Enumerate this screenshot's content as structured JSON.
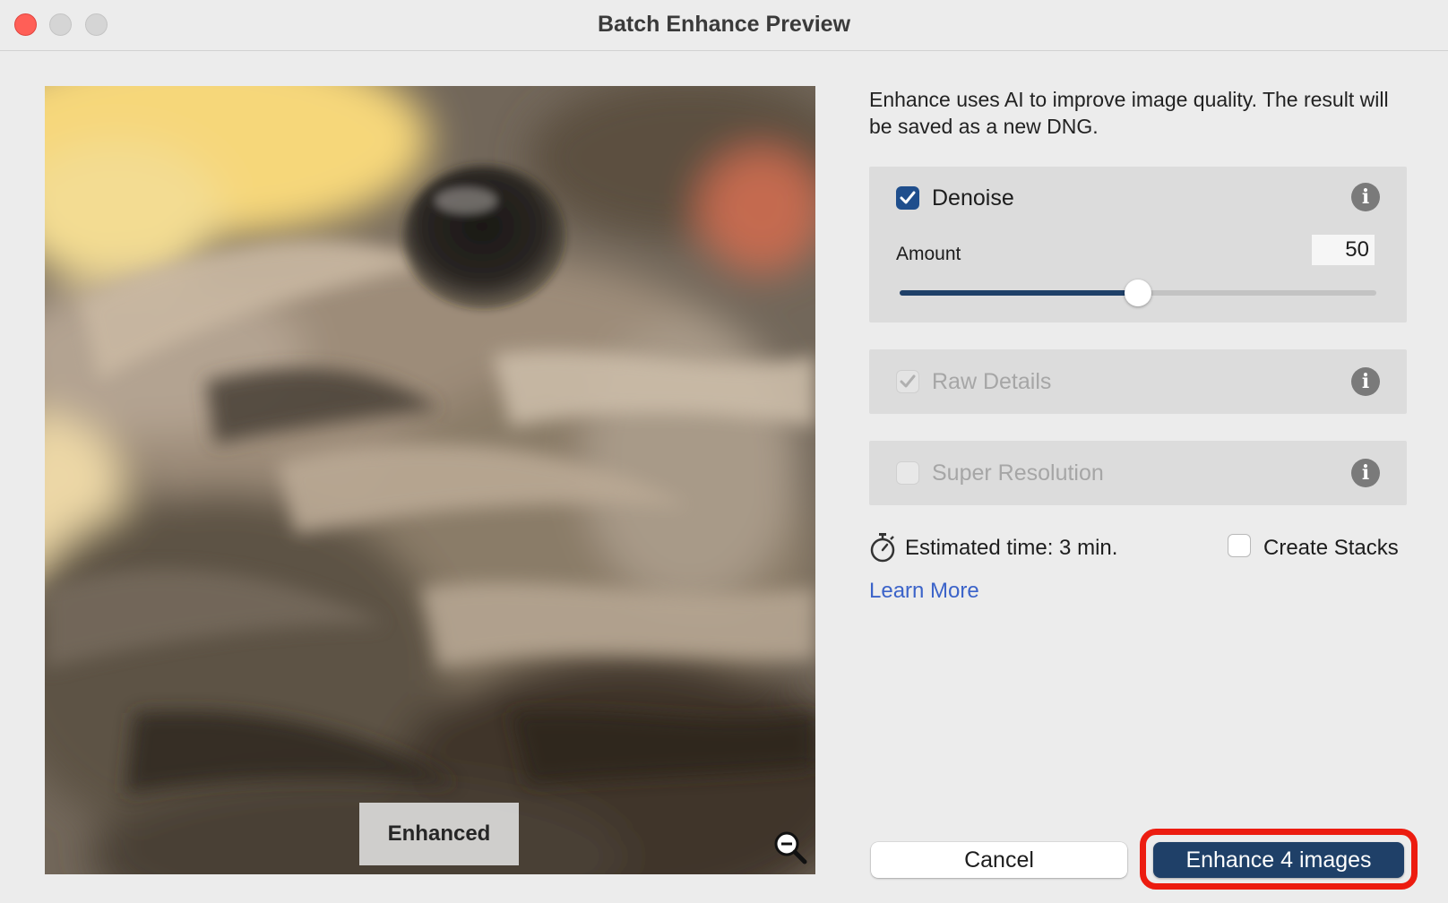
{
  "window": {
    "title": "Batch Enhance Preview"
  },
  "preview": {
    "overlay_label": "Enhanced",
    "zoom_icon": "zoom-out-icon"
  },
  "panel": {
    "description": "Enhance uses AI to improve image quality. The result will be saved as a new DNG.",
    "denoise": {
      "label": "Denoise",
      "checked": true,
      "amount_label": "Amount",
      "amount_value": "50",
      "amount_fraction": 0.5,
      "info_icon": "info-icon"
    },
    "raw_details": {
      "label": "Raw Details",
      "checked": true,
      "disabled": true,
      "info_icon": "info-icon"
    },
    "super_resolution": {
      "label": "Super Resolution",
      "checked": false,
      "disabled": true,
      "info_icon": "info-icon"
    },
    "estimate": {
      "text": "Estimated time: 3 min.",
      "icon": "timer-icon"
    },
    "create_stacks": {
      "label": "Create Stacks",
      "checked": false
    },
    "learn_more": "Learn More"
  },
  "buttons": {
    "cancel": "Cancel",
    "enhance": "Enhance 4 images"
  },
  "colors": {
    "accent": "#1f4068",
    "highlight": "#ec1c10",
    "link": "#3b63c9",
    "close": "#ff5f57"
  }
}
